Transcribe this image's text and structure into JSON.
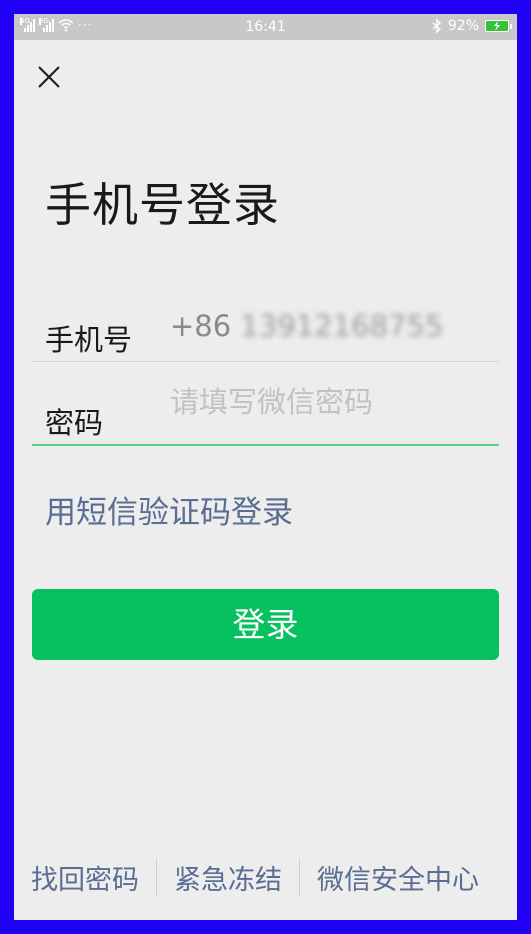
{
  "status_bar": {
    "network_1": "4G",
    "network_2": "3G",
    "more": "···",
    "time": "16:41",
    "bluetooth": "bluetooth-icon",
    "battery_percent": "92%",
    "battery_color": "#35c235"
  },
  "header": {
    "close_icon": "close-icon"
  },
  "main": {
    "title": "手机号登录",
    "phone_label": "手机号",
    "phone_prefix": "+86 ",
    "phone_number_masked": "13912168755",
    "password_label": "密码",
    "password_placeholder": "请填写微信密码",
    "password_value": "",
    "sms_login_link": "用短信验证码登录",
    "login_button": "登录"
  },
  "footer": {
    "links": [
      "找回密码",
      "紧急冻结",
      "微信安全中心"
    ]
  },
  "colors": {
    "accent_green": "#07c160",
    "link_blue": "#5a6d93",
    "focus_line": "#5fcf8b",
    "frame": "#1f00f5"
  }
}
